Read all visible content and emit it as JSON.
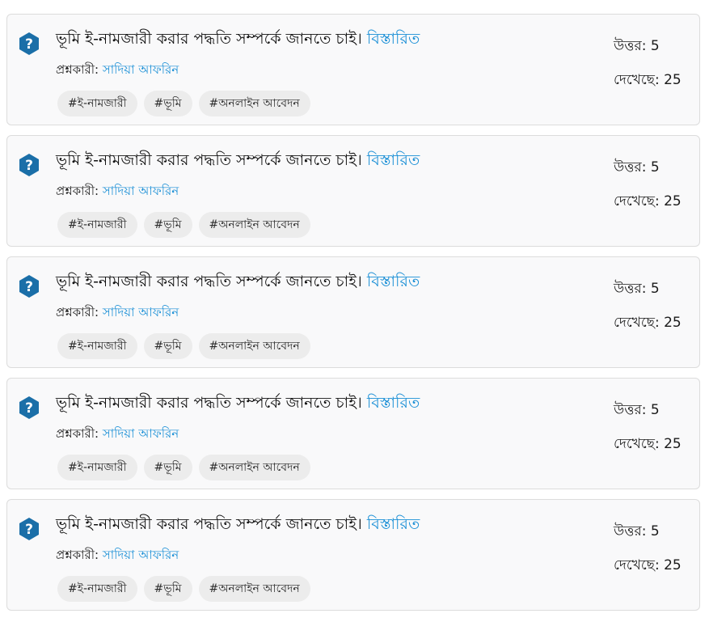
{
  "questions": [
    {
      "title": "ভূমি ই-নামজারী করার পদ্ধতি সম্পর্কে জানতে চাই।",
      "details_label": "বিস্তারিত",
      "asker_label": "প্রশ্নকারী:",
      "asker_name": "সাদিয়া আফরিন",
      "tags": [
        "#ই-নামজারী",
        "#ভূমি",
        "#অনলাইন আবেদন"
      ],
      "answers_label": "উত্তর:",
      "answers": "5",
      "views_label": "দেখেছে:",
      "views": "25"
    },
    {
      "title": "ভূমি ই-নামজারী করার পদ্ধতি সম্পর্কে জানতে চাই।",
      "details_label": "বিস্তারিত",
      "asker_label": "প্রশ্নকারী:",
      "asker_name": "সাদিয়া আফরিন",
      "tags": [
        "#ই-নামজারী",
        "#ভূমি",
        "#অনলাইন আবেদন"
      ],
      "answers_label": "উত্তর:",
      "answers": "5",
      "views_label": "দেখেছে:",
      "views": "25"
    },
    {
      "title": "ভূমি ই-নামজারী করার পদ্ধতি সম্পর্কে জানতে চাই।",
      "details_label": "বিস্তারিত",
      "asker_label": "প্রশ্নকারী:",
      "asker_name": "সাদিয়া আফরিন",
      "tags": [
        "#ই-নামজারী",
        "#ভূমি",
        "#অনলাইন আবেদন"
      ],
      "answers_label": "উত্তর:",
      "answers": "5",
      "views_label": "দেখেছে:",
      "views": "25"
    },
    {
      "title": "ভূমি ই-নামজারী করার পদ্ধতি সম্পর্কে জানতে চাই।",
      "details_label": "বিস্তারিত",
      "asker_label": "প্রশ্নকারী:",
      "asker_name": "সাদিয়া আফরিন",
      "tags": [
        "#ই-নামজারী",
        "#ভূমি",
        "#অনলাইন আবেদন"
      ],
      "answers_label": "উত্তর:",
      "answers": "5",
      "views_label": "দেখেছে:",
      "views": "25"
    },
    {
      "title": "ভূমি ই-নামজারী করার পদ্ধতি সম্পর্কে জানতে চাই।",
      "details_label": "বিস্তারিত",
      "asker_label": "প্রশ্নকারী:",
      "asker_name": "সাদিয়া আফরিন",
      "tags": [
        "#ই-নামজারী",
        "#ভূমি",
        "#অনলাইন আবেদন"
      ],
      "answers_label": "উত্তর:",
      "answers": "5",
      "views_label": "দেখেছে:",
      "views": "25"
    }
  ],
  "icons": {
    "question": "question-mark-badge-icon"
  },
  "colors": {
    "icon_fill": "#1b6fa8",
    "link": "#1a8fd6",
    "tag_bg": "#ececec",
    "card_bg": "#f9f9fa",
    "card_border": "#dcdcdc"
  }
}
